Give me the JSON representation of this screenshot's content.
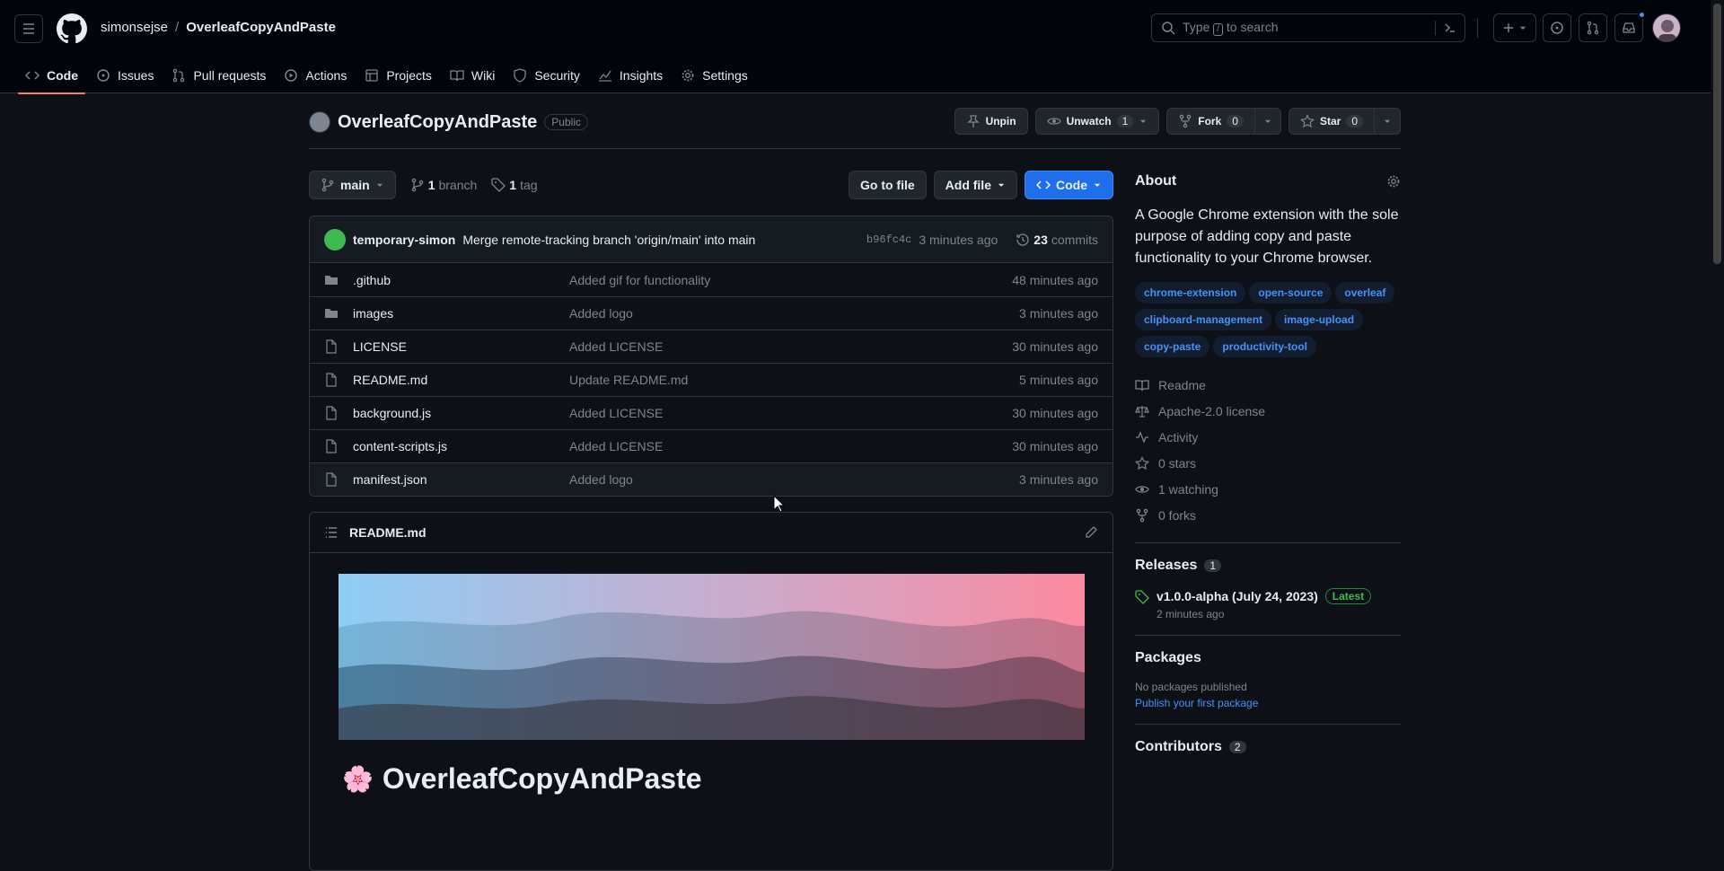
{
  "header": {
    "owner": "simonsejse",
    "separator": "/",
    "repo": "OverleafCopyAndPaste",
    "search_placeholder": "Type / to search",
    "search_placeholder_pre": "Type",
    "search_placeholder_key": "/",
    "search_placeholder_post": "to search"
  },
  "tabs": [
    {
      "label": "Code"
    },
    {
      "label": "Issues"
    },
    {
      "label": "Pull requests"
    },
    {
      "label": "Actions"
    },
    {
      "label": "Projects"
    },
    {
      "label": "Wiki"
    },
    {
      "label": "Security"
    },
    {
      "label": "Insights"
    },
    {
      "label": "Settings"
    }
  ],
  "repo": {
    "name": "OverleafCopyAndPaste",
    "visibility": "Public",
    "unpin": "Unpin",
    "unwatch": "Unwatch",
    "watch_count": "1",
    "fork": "Fork",
    "fork_count": "0",
    "star": "Star",
    "star_count": "0"
  },
  "controls": {
    "branch": "main",
    "branches_count": "1",
    "branches_label": "branch",
    "tags_count": "1",
    "tags_label": "tag",
    "go_to_file": "Go to file",
    "add_file": "Add file",
    "code": "Code"
  },
  "commit": {
    "author": "temporary-simon",
    "message": "Merge remote-tracking branch 'origin/main' into main",
    "hash": "b96fc4c",
    "time": "3 minutes ago",
    "count": "23",
    "count_label": "commits"
  },
  "files": [
    {
      "name": ".github",
      "type": "folder",
      "message": "Added gif for functionality",
      "time": "48 minutes ago"
    },
    {
      "name": "images",
      "type": "folder",
      "message": "Added logo",
      "time": "3 minutes ago"
    },
    {
      "name": "LICENSE",
      "type": "file",
      "message": "Added LICENSE",
      "time": "30 minutes ago"
    },
    {
      "name": "README.md",
      "type": "file",
      "message": "Update README.md",
      "time": "5 minutes ago"
    },
    {
      "name": "background.js",
      "type": "file",
      "message": "Added LICENSE",
      "time": "30 minutes ago"
    },
    {
      "name": "content-scripts.js",
      "type": "file",
      "message": "Added LICENSE",
      "time": "30 minutes ago"
    },
    {
      "name": "manifest.json",
      "type": "file",
      "message": "Added logo",
      "time": "3 minutes ago"
    }
  ],
  "readme": {
    "filename": "README.md",
    "title": "OverleafCopyAndPaste",
    "emoji": "🌸"
  },
  "about": {
    "heading": "About",
    "description": "A Google Chrome extension with the sole purpose of adding copy and paste functionality to your Chrome browser.",
    "topics": [
      "chrome-extension",
      "open-source",
      "overleaf",
      "clipboard-management",
      "image-upload",
      "copy-paste",
      "productivity-tool"
    ],
    "readme": "Readme",
    "license": "Apache-2.0 license",
    "activity": "Activity",
    "stars": "0 stars",
    "watching": "1 watching",
    "forks": "0 forks"
  },
  "releases": {
    "heading": "Releases",
    "count": "1",
    "tag": "v1.0.0-alpha (July 24, 2023)",
    "latest": "Latest",
    "time": "2 minutes ago"
  },
  "packages": {
    "heading": "Packages",
    "none": "No packages published",
    "publish_link": "Publish your first package"
  },
  "contributors": {
    "heading": "Contributors",
    "count": "2"
  },
  "colors": {
    "accent": "#4493f8",
    "primary_button": "#1f6feb",
    "tab_underline": "#f78166"
  }
}
